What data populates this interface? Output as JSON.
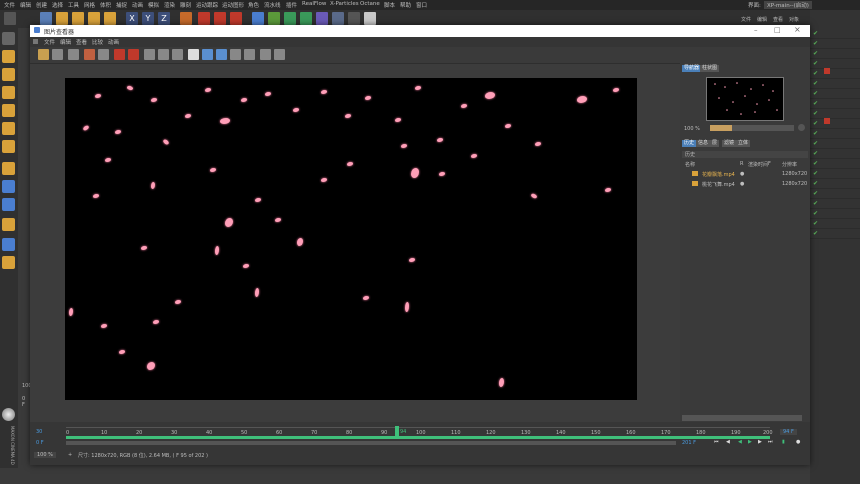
{
  "menubar": {
    "items": [
      "文件",
      "编辑",
      "创建",
      "选择",
      "工具",
      "网格",
      "体积",
      "捕捉",
      "动画",
      "模拟",
      "渲染",
      "雕刻",
      "运动跟踪",
      "运动图形",
      "角色",
      "流水线",
      "插件",
      "RealFlow",
      "X-Particles",
      "Octane",
      "脚本",
      "帮助",
      "窗口"
    ],
    "layout_label": "界面:",
    "layout_value": "XP-main--(启动)"
  },
  "right_header": {
    "tabs": [
      "文件",
      "编辑",
      "查看",
      "对象"
    ]
  },
  "viewer": {
    "title": "图片查看器",
    "menu": [
      "文件",
      "编辑",
      "查看",
      "比较",
      "动画"
    ],
    "zoom": "100 %",
    "status": "尺寸: 1280x720, RGB (8 位), 2.64 MB,  ( F 95 of 202 )",
    "panel_tabs": [
      "导航器",
      "柱状图"
    ],
    "nav_zoom": "100 %",
    "info_tabs": [
      "历史",
      "信息",
      "层",
      "滤镜",
      "立体"
    ],
    "history_label": "历史",
    "columns": [
      "名称",
      "R",
      "渲染时间",
      "F",
      "分辨率"
    ],
    "files": [
      {
        "name": "花瓣飘落.mp4",
        "res": "1280x720"
      },
      {
        "name": "桃花飞舞.mp4",
        "res": "1280x720"
      }
    ],
    "timeline": {
      "ticks": [
        "0",
        "10",
        "20",
        "30",
        "40",
        "50",
        "60",
        "70",
        "80",
        "90",
        "100",
        "110",
        "120",
        "130",
        "140",
        "150",
        "160",
        "170",
        "180",
        "190",
        "200"
      ],
      "current": "94",
      "start": "0 F",
      "end": "201 F",
      "frame_box": "94 F",
      "left_val": "30",
      "left_val2": "0 F"
    }
  },
  "c4d_left": {
    "side_val": "100",
    "side_val2": "0 F"
  },
  "branding": "MAXON CINEMA 4D",
  "colors": {
    "accent": "#4a9be0",
    "petal": "#ff9fb8",
    "check": "#5ab45a",
    "timeline_green": "#3fbf7a"
  }
}
